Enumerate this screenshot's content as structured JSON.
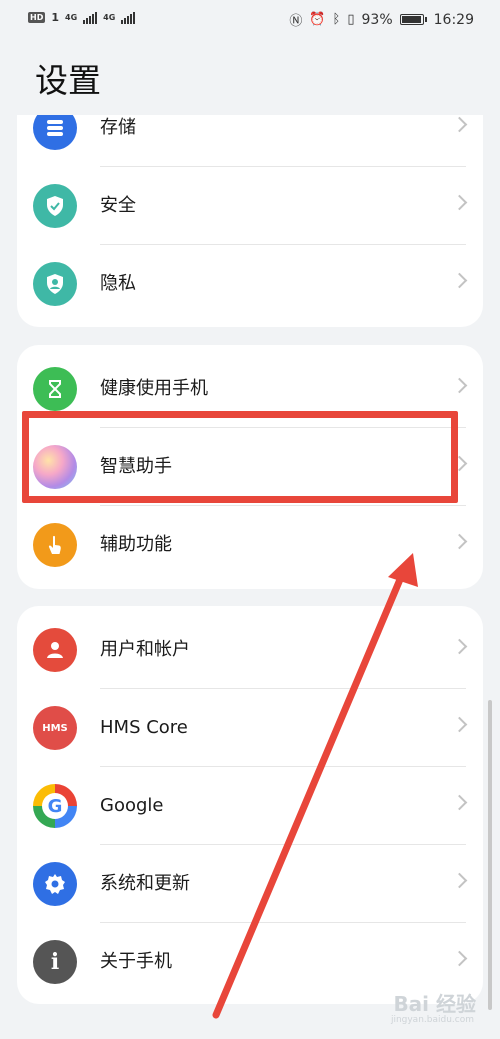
{
  "status_bar": {
    "left_badge": "HD",
    "sim1": "1",
    "net1": "4G",
    "net2": "4G",
    "battery_pct": "93%",
    "time": "16:29"
  },
  "page": {
    "title": "设置"
  },
  "card1": {
    "items": [
      {
        "label": "存储",
        "icon": "storage-icon",
        "color": "#2f6fe4"
      },
      {
        "label": "安全",
        "icon": "security-shield-icon",
        "color": "#3fb8a6"
      },
      {
        "label": "隐私",
        "icon": "privacy-user-icon",
        "color": "#3fb8a6"
      }
    ]
  },
  "card2": {
    "items": [
      {
        "label": "健康使用手机",
        "icon": "hourglass-icon",
        "color": "#3dbd55"
      },
      {
        "label": "智慧助手",
        "icon": "assistant-orb-icon",
        "color": "#c27ad8"
      },
      {
        "label": "辅助功能",
        "icon": "accessibility-hand-icon",
        "color": "#f29a1a"
      }
    ]
  },
  "card3": {
    "items": [
      {
        "label": "用户和帐户",
        "icon": "user-account-icon",
        "color": "#e44b3c"
      },
      {
        "label": "HMS Core",
        "icon": "hms-icon",
        "color": "#e04d48"
      },
      {
        "label": "Google",
        "icon": "google-g-icon",
        "color": "#ffffff"
      },
      {
        "label": "系统和更新",
        "icon": "system-gear-icon",
        "color": "#2f6fe4"
      },
      {
        "label": "关于手机",
        "icon": "info-icon",
        "color": "#555555"
      }
    ]
  },
  "hms_text": "HMS",
  "annotation": {
    "highlight_color": "#e8463a"
  },
  "watermark": {
    "text": "Bai 经验",
    "sub": "jingyan.baidu.com"
  }
}
